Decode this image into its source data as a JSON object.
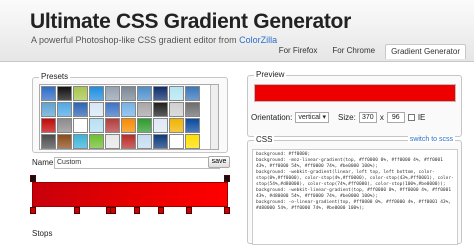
{
  "header": {
    "title": "Ultimate CSS Gradient Generator",
    "subtitle": "A powerful Photoshop-like CSS gradient editor from",
    "subtitle_link": "ColorZilla"
  },
  "tabs": [
    {
      "label": "For Firefox"
    },
    {
      "label": "For Chrome"
    },
    {
      "label": "Gradient Generator",
      "active": true
    }
  ],
  "presets": {
    "label": "Presets",
    "swatch_colors": [
      "#2e6dc7",
      "#111111",
      "#a8c64d",
      "#1d8ee0",
      "#95a2b2",
      "#7a8896",
      "#4c8ec9",
      "#0f2e6e",
      "#b3e5f2",
      "#3a77bc",
      "#5ea4d3",
      "#4fa9e6",
      "#2d64b6",
      "#d7e7f6",
      "#3e74c6",
      "#75b2e6",
      "#a7a7a7",
      "#202020",
      "#cfcfcf",
      "#6e6e6e",
      "#c40808",
      "#8c8c8c",
      "#ffffff",
      "#b6e0f4",
      "#b43c3c",
      "#f78b00",
      "#2e9a2e",
      "#dfe9f6",
      "#f0b400",
      "#0a4aa0",
      "#4c4c4c",
      "#8b4c1a",
      "#3bb2d8",
      "#6fbf2f",
      "#e8e8e8",
      "#b92b27",
      "#c3dcef",
      "#0b3a7c",
      "#ffffff",
      "#ffe000"
    ]
  },
  "name": {
    "label": "Name:",
    "value": "Custom",
    "save": "save"
  },
  "stops_label": "Stops",
  "preview": {
    "label": "Preview",
    "color": "#ee0000",
    "orientation_label": "Orientation:",
    "orientation": "vertical",
    "size_label": "Size:",
    "width": "370",
    "x": "x",
    "height": "96",
    "ie_label": "IE"
  },
  "css": {
    "label": "CSS",
    "switch": "switch to scss",
    "code": "background: #ff0000;\nbackground: -moz-linear-gradient(top, #ff0000 0%, #ff0000 4%, #ff0001 43%, #ff0000 54%, #ff0000 74%, #be0000 100%);\nbackground: -webkit-gradient(linear, left top, left bottom, color-stop(0%,#ff0000), color-stop(4%,#ff0000), color-stop(43%,#ff0001), color-stop(54%,#d80000), color-stop(74%,#ff0000), color-stop(100%,#be0000));\nbackground: -webkit-linear-gradient(top, #ff0000 0%, #ff0000 4%, #ff0001 43%, #d80000 54%, #ff0000 74%, #be0000 100%);\nbackground: -o-linear-gradient(top, #ff0000 0%, #ff0000 4%, #ff0001 43%, #d80000 54%, #ff0000 74%, #be0000 100%);"
  }
}
